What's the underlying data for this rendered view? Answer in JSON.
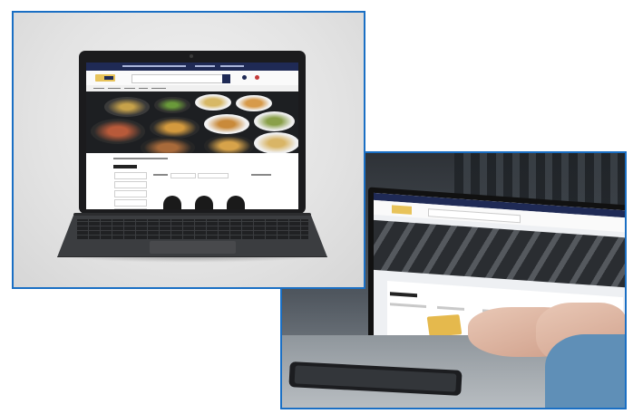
{
  "photos": [
    {
      "subject": "front-laptop-mockup",
      "border_color": "#1a6fc4",
      "screen_site": {
        "brand_color": "#1f2a55",
        "accent_color": "#e8c35a",
        "hero": "food-bowls"
      }
    },
    {
      "subject": "hands-typing-on-laptop",
      "border_color": "#1a6fc4",
      "screen_site": {
        "brand_color": "#1f2a55",
        "accent_color": "#e8c35a",
        "hero": "dark-trays"
      }
    }
  ]
}
